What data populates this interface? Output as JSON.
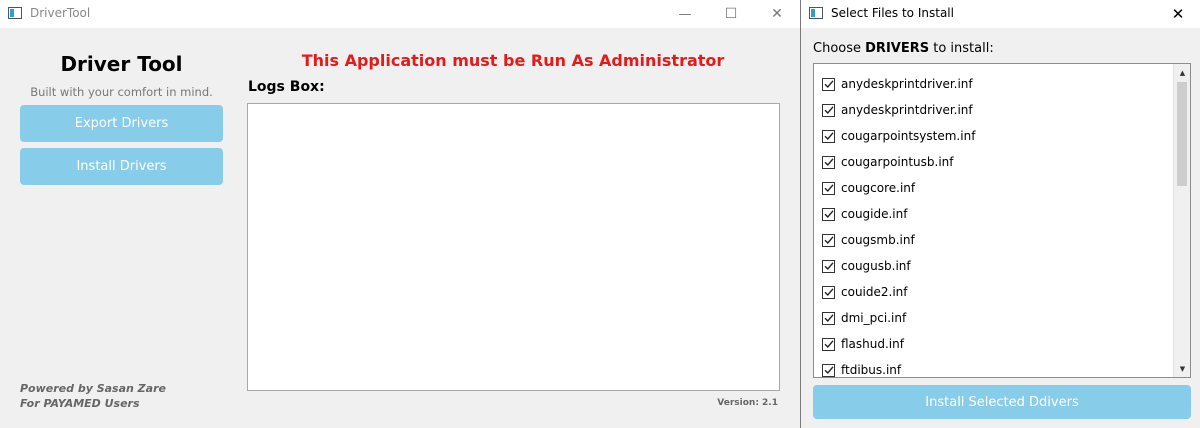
{
  "main_window": {
    "title": "DriverTool",
    "controls": {
      "minimize": "—",
      "maximize": "☐",
      "close": "✕"
    },
    "app_title": "Driver Tool",
    "subtitle": "Built with your comfort in mind.",
    "export_button": "Export Drivers",
    "install_button": "Install Drivers",
    "admin_warning": "This Application must be Run As Administrator",
    "logs_label": "Logs Box:",
    "powered_line1": "Powered by Sasan Zare",
    "powered_line2": "For PAYAMED Users",
    "version": "Version: 2.1",
    "warning_color": "#e31b1b",
    "accent_color": "#87cde9"
  },
  "dialog": {
    "title": "Select Files to Install",
    "close": "✕",
    "choose_prefix": "Choose ",
    "choose_bold": "DRIVERS",
    "choose_suffix": " to install:",
    "items": [
      {
        "label": "anydeskprintdriver.inf",
        "checked": true
      },
      {
        "label": "anydeskprintdriver.inf",
        "checked": true
      },
      {
        "label": "cougarpointsystem.inf",
        "checked": true
      },
      {
        "label": "cougarpointusb.inf",
        "checked": true
      },
      {
        "label": "cougcore.inf",
        "checked": true
      },
      {
        "label": "cougide.inf",
        "checked": true
      },
      {
        "label": "cougsmb.inf",
        "checked": true
      },
      {
        "label": "cougusb.inf",
        "checked": true
      },
      {
        "label": "couide2.inf",
        "checked": true
      },
      {
        "label": "dmi_pci.inf",
        "checked": true
      },
      {
        "label": "flashud.inf",
        "checked": true
      },
      {
        "label": "ftdibus.inf",
        "checked": true
      }
    ],
    "scroll_up": "▲",
    "scroll_down": "▼",
    "install_selected_button": "Install Selected Ddivers"
  }
}
